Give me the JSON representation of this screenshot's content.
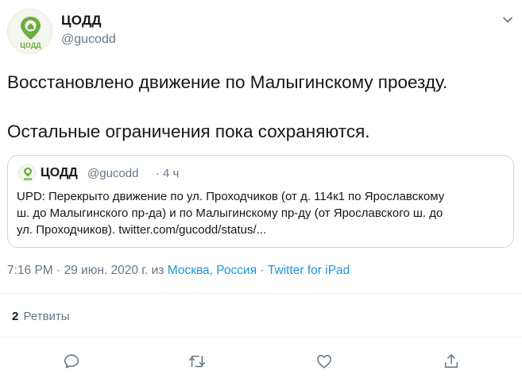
{
  "author": {
    "name": "ЦОДД",
    "handle": "@gucodd",
    "avatar_text": "ЦОДД",
    "avatar_color": "#6bae3c"
  },
  "tweet": {
    "line1": "Восстановлено движение по Малыгинскому проезду.",
    "line2": "Остальные ограничения пока сохраняются."
  },
  "quote": {
    "name": "ЦОДД",
    "handle": "@gucodd",
    "separator": "·",
    "time": "4 ч",
    "line1": "UPD: Перекрыто движение по ул. Проходчиков (от д. 114к1 по Ярославскому",
    "line2": "ш. до Малыгинского пр-да) и по Малыгинскому пр-ду (от Ярославского ш. до",
    "line3": "ул. Проходчиков). twitter.com/gucodd/status/..."
  },
  "meta": {
    "time_date": "7:16 PM · 29 июн. 2020 г. из ",
    "location": "Москва, Россия",
    "separator": " · ",
    "source": "Twitter for iPad"
  },
  "stats": {
    "retweet_count": "2",
    "retweet_label": "Ретвиты"
  },
  "icons": {
    "more": "chevron-down-icon",
    "reply": "reply-icon",
    "retweet": "retweet-icon",
    "like": "heart-icon",
    "share": "share-icon"
  },
  "colors": {
    "link": "#1b95e0",
    "secondary_text": "#657786",
    "icon_gray": "#657786",
    "brand_green": "#6bae3c"
  }
}
